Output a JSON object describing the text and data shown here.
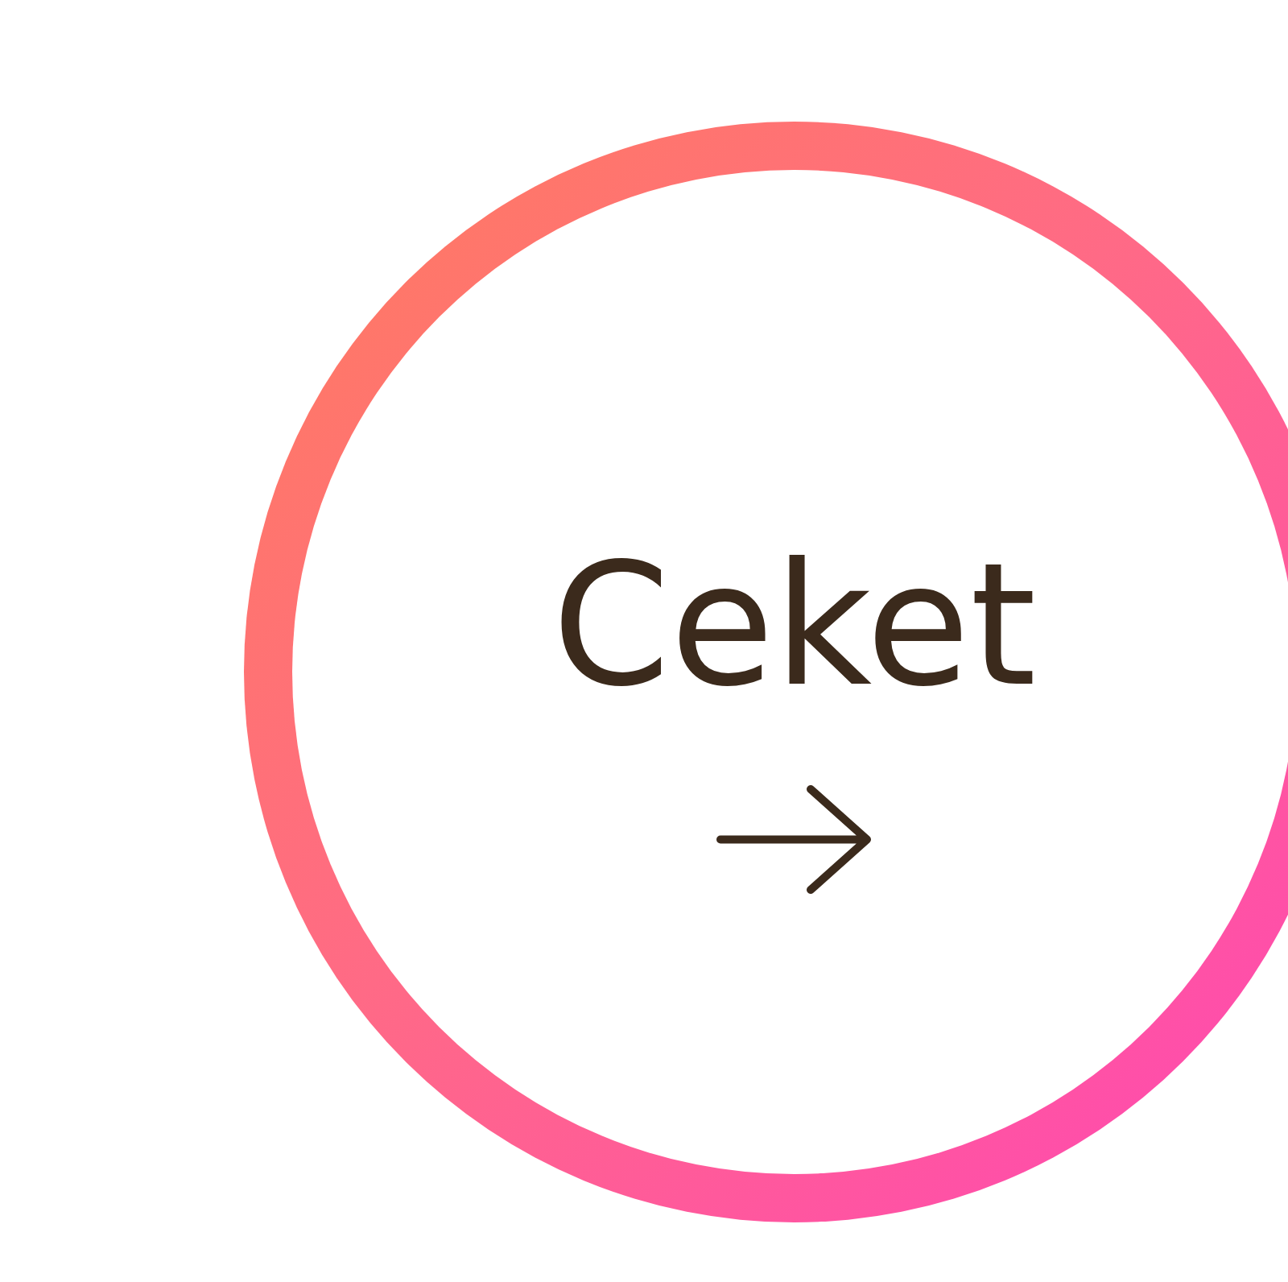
{
  "category_link": {
    "label": "Ceket"
  }
}
